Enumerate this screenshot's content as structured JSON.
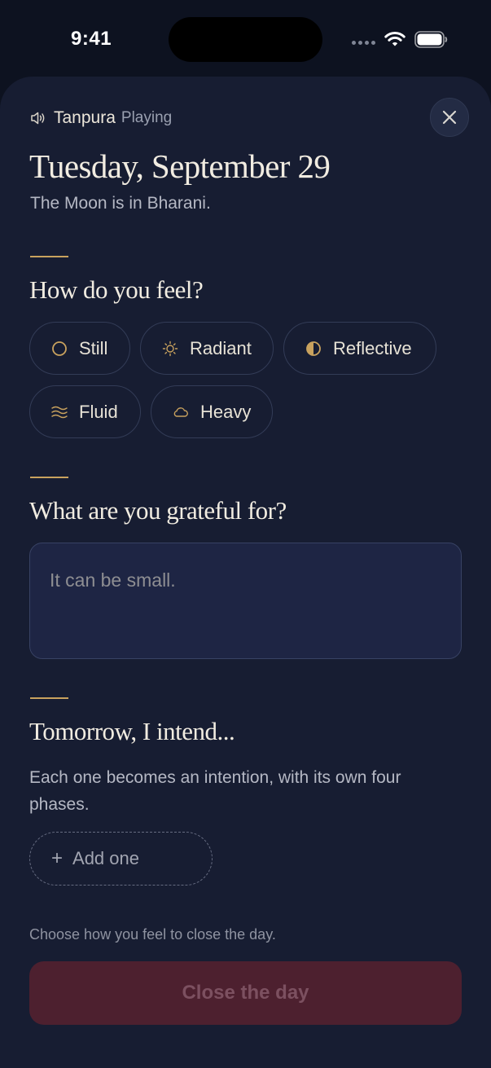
{
  "status_bar": {
    "time": "9:41"
  },
  "audio": {
    "name": "Tanpura",
    "status": "Playing",
    "icon": "speaker-icon"
  },
  "header": {
    "date": "Tuesday, September 29",
    "moon": "The Moon is in Bharani."
  },
  "feel": {
    "title": "How do you feel?",
    "options": [
      {
        "label": "Still",
        "icon": "circle-outline-icon"
      },
      {
        "label": "Radiant",
        "icon": "sun-icon"
      },
      {
        "label": "Reflective",
        "icon": "half-circle-icon"
      },
      {
        "label": "Fluid",
        "icon": "waves-icon"
      },
      {
        "label": "Heavy",
        "icon": "cloud-icon"
      }
    ]
  },
  "grateful": {
    "title": "What are you grateful for?",
    "placeholder": "It can be small."
  },
  "intend": {
    "title": "Tomorrow, I intend...",
    "description": "Each one becomes an intention, with its own four phases.",
    "add_label": "Add one",
    "add_symbol": "+"
  },
  "footer": {
    "hint": "Choose how you feel to close the day.",
    "button_label": "Close the day"
  },
  "colors": {
    "accent": "#c9a25e",
    "sheet": "#171d32",
    "button": "#4d202f"
  }
}
